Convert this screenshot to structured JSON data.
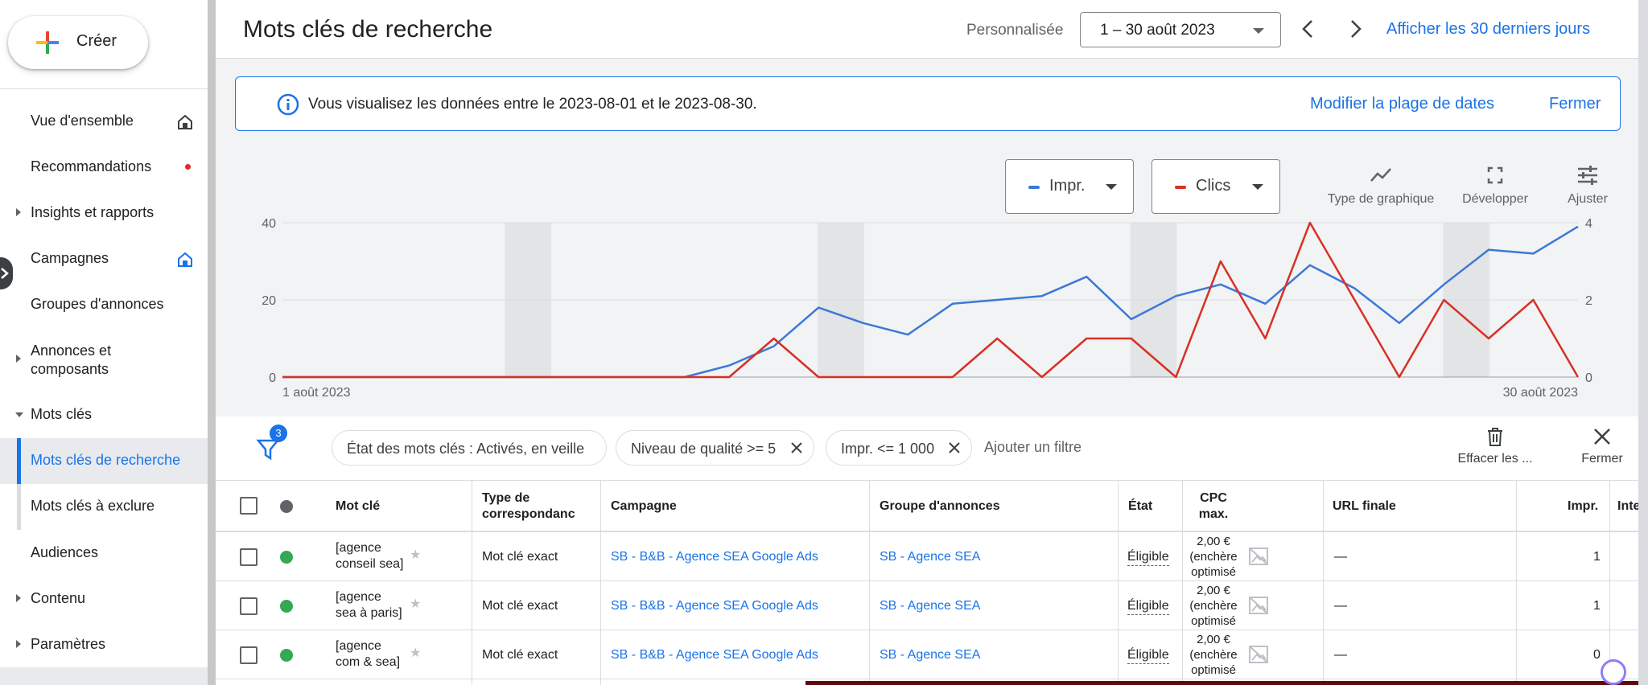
{
  "sidebar": {
    "create_label": "Créer",
    "items": [
      {
        "label": "Vue d'ensemble"
      },
      {
        "label": "Recommandations"
      },
      {
        "label": "Insights et rapports"
      },
      {
        "label": "Campagnes"
      },
      {
        "label": "Groupes d'annonces"
      },
      {
        "label": "Annonces et\ncomposants"
      },
      {
        "label": "Mots clés"
      },
      {
        "label": "Mots clés de recherche"
      },
      {
        "label": "Mots clés à exclure"
      },
      {
        "label": "Audiences"
      },
      {
        "label": "Contenu"
      },
      {
        "label": "Paramètres"
      }
    ]
  },
  "header": {
    "title": "Mots clés de recherche",
    "custom_label": "Personnalisée",
    "date_range": "1 – 30 août 2023",
    "last30_link": "Afficher les 30 derniers jours"
  },
  "info": {
    "text": "Vous visualisez les données entre le 2023-08-01 et le 2023-08-30.",
    "modify_link": "Modifier la plage de dates",
    "close_link": "Fermer"
  },
  "metrics": {
    "m1": "Impr.",
    "m2": "Clics",
    "m1_color": "#3c78d8",
    "m2_color": "#d93025"
  },
  "chart_tools": {
    "type_label": "Type de graphique",
    "expand_label": "Développer",
    "adjust_label": "Ajuster"
  },
  "chart_data": {
    "type": "line",
    "x_start_label": "1 août 2023",
    "x_end_label": "30 août 2023",
    "y_left_ticks": [
      "0",
      "20",
      "40"
    ],
    "y_right_ticks": [
      "0",
      "2",
      "4"
    ],
    "ylim_left": [
      0,
      40
    ],
    "ylim_right": [
      0,
      4
    ],
    "grid": true,
    "weekend_bands": [
      [
        5,
        6
      ],
      [
        12,
        13
      ],
      [
        19,
        20
      ],
      [
        26,
        27
      ]
    ],
    "series": [
      {
        "name": "Impr.",
        "axis": "left",
        "color": "#3c78d8",
        "values": [
          0,
          0,
          0,
          0,
          0,
          0,
          0,
          0,
          0,
          0,
          3,
          8,
          18,
          14,
          11,
          19,
          20,
          21,
          26,
          15,
          21,
          24,
          19,
          29,
          23,
          14,
          24,
          33,
          32,
          39
        ]
      },
      {
        "name": "Clics",
        "axis": "right",
        "color": "#d93025",
        "values": [
          0,
          0,
          0,
          0,
          0,
          0,
          0,
          0,
          0,
          0,
          0,
          1,
          0,
          0,
          0,
          0,
          1,
          0,
          1,
          1,
          0,
          3,
          1,
          4,
          2,
          0,
          2,
          1,
          2,
          0
        ]
      }
    ]
  },
  "filters": {
    "count": "3",
    "chips": [
      "État des mots clés : Activés, en veille",
      "Niveau de qualité >= 5",
      "Impr. <= 1 000"
    ],
    "add_filter": "Ajouter un filtre",
    "clear_label": "Effacer les ...",
    "close_label": "Fermer"
  },
  "table": {
    "headers": {
      "keyword": "Mot clé",
      "match_type": "Type de\ncorrespondanc",
      "campaign": "Campagne",
      "ad_group": "Groupe d'annonces",
      "status": "État",
      "cpc": "CPC\nmax.",
      "final_url": "URL finale",
      "impr": "Impr.",
      "inter": "Inte"
    },
    "rows": [
      {
        "keyword": "[agence\nconseil sea]",
        "match": "Mot clé exact",
        "campaign": "SB - B&B - Agence SEA Google Ads",
        "ad_group": "SB - Agence SEA",
        "status": "Éligible",
        "cpc": "2,00 €\n(enchère\noptimisé",
        "url": "—",
        "impr": "1"
      },
      {
        "keyword": "[agence\nsea à paris]",
        "match": "Mot clé exact",
        "campaign": "SB - B&B - Agence SEA Google Ads",
        "ad_group": "SB - Agence SEA",
        "status": "Éligible",
        "cpc": "2,00 €\n(enchère\noptimisé",
        "url": "—",
        "impr": "1"
      },
      {
        "keyword": "[agence\ncom & sea]",
        "match": "Mot clé exact",
        "campaign": "SB - B&B - Agence SEA Google Ads",
        "ad_group": "SB - Agence SEA",
        "status": "Éligible",
        "cpc": "2,00 €\n(enchère\noptimisé",
        "url": "—",
        "impr": "0"
      }
    ]
  }
}
